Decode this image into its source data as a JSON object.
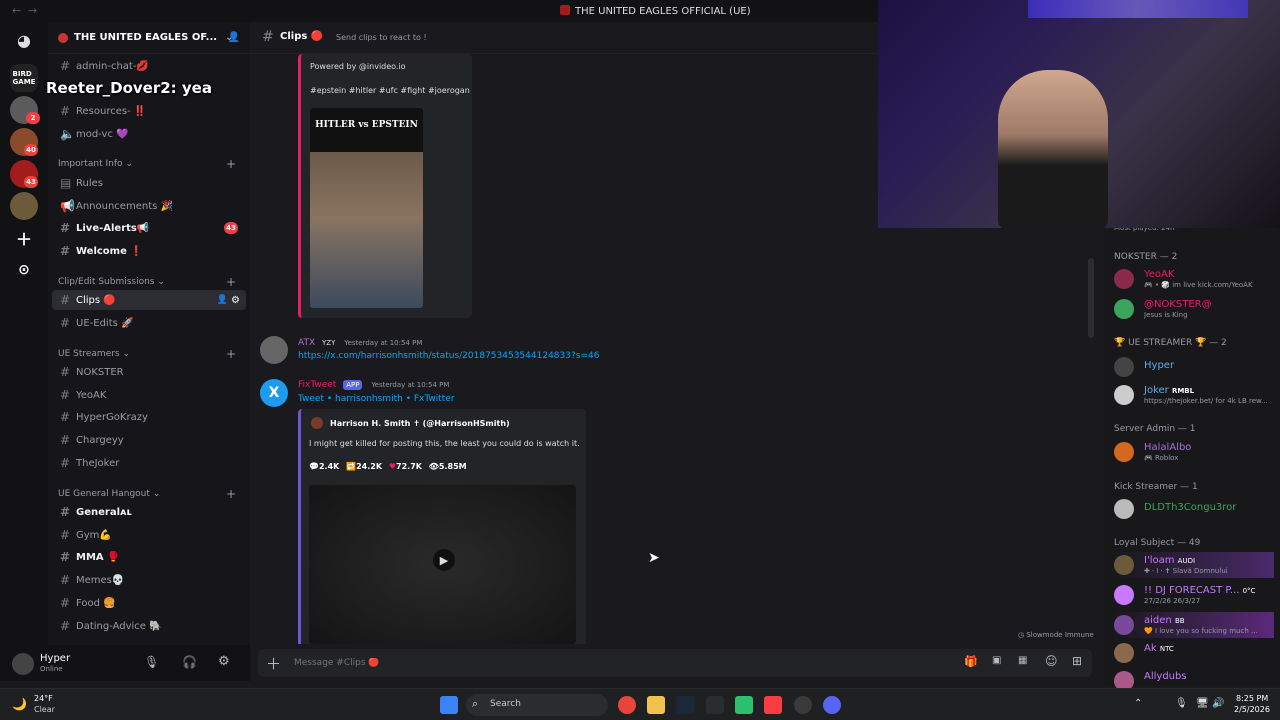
{
  "window": {
    "title": "THE UNITED EAGLES OFFICIAL (UE)"
  },
  "overlay_chat": {
    "text": "Reeter_Dover2: yea"
  },
  "server": {
    "name": "THE UNITED EAGLES OF..."
  },
  "server_rail": {
    "badges": [
      "2",
      "40",
      "43"
    ]
  },
  "channels": {
    "top": [
      {
        "label": "admin-chat-💋"
      },
      {
        "label": "Resources- ‼️"
      },
      {
        "label": "mod-vc 💜"
      }
    ],
    "categories": {
      "important": "Important Info",
      "clip_edit": "Clip/Edit Submissions",
      "streamers": "UE Streamers",
      "hangout": "UE General Hangout"
    },
    "important": [
      {
        "label": "Rules"
      },
      {
        "label": "Announcements 🎉"
      },
      {
        "label": "Live-Alerts📢",
        "badge": "43"
      },
      {
        "label": "Welcome ❗"
      }
    ],
    "clip_edit": [
      {
        "label": "Clips 🔴"
      },
      {
        "label": "UE-Edits 🚀"
      }
    ],
    "streamers": [
      {
        "label": "NOKSTER"
      },
      {
        "label": "YeoAK"
      },
      {
        "label": "HyperGoKrazy"
      },
      {
        "label": "Chargeyy"
      },
      {
        "label": "TheJoker"
      }
    ],
    "hangout": [
      {
        "label": "Generalᴀʟ"
      },
      {
        "label": "Gym💪"
      },
      {
        "label": "MMA 🥊"
      },
      {
        "label": "Memes💀"
      },
      {
        "label": "Food 🍔"
      },
      {
        "label": "Dating-Advice 🐘"
      }
    ]
  },
  "user": {
    "name": "Hyper",
    "status": "Online"
  },
  "channel_header": {
    "name": "Clips 🔴",
    "topic": "Send clips to react to !"
  },
  "messages": {
    "m0": {
      "powered_by": "Powered by @invideo.io",
      "tags": "#epstein #hitler #ufc #fight #joerogan",
      "thumb_title": "HITLER vs EPSTEIN"
    },
    "m1": {
      "author": "ATX",
      "tag": "YZY",
      "time": "Yesterday at 10:54 PM",
      "link": "https://x.com/harrisonhsmith/status/2018753453544124833?s=46"
    },
    "m2": {
      "author": "FixTweet",
      "app_tag": "APP",
      "time": "Yesterday at 10:54 PM",
      "source_tweet": "Tweet",
      "source_sep1": "•",
      "source_author": "harrisonhsmith",
      "source_sep2": "•",
      "source_site": "FxTwitter",
      "embed_author": "Harrison H. Smith ✝ (@HarrisonHSmith)",
      "embed_text": "I might get killed for posting this, the least you could do is watch it.",
      "stats": {
        "replies": "2.4K",
        "retweets": "24.2K",
        "likes": "72.7K",
        "views": "5.85M"
      }
    }
  },
  "slowmode": "Slowmode Immune",
  "input": {
    "placeholder": "Message #Clips 🔴"
  },
  "members": {
    "cut_top": "Most played: 24h",
    "groups": [
      {
        "title": "NOKSTER — 2"
      },
      {
        "title": "🏆 UE STREAMER 🏆 — 2"
      },
      {
        "title": "Server Admin — 1"
      },
      {
        "title": "Kick Streamer — 1"
      },
      {
        "title": "Loyal Subject — 49"
      }
    ],
    "list": [
      {
        "name": "YeoAK",
        "status": "🎮 • 🎲 im live kick.com/YeoAK",
        "color": "#e91e63"
      },
      {
        "name": "@NOKSTER@",
        "status": "Jesus is King",
        "color": "#e91e63"
      },
      {
        "name": "Hyper",
        "status": "",
        "color": "#5dadec"
      },
      {
        "name": "Joker",
        "tag": "RMBL",
        "status": "https://thejoker.bet/ for 4k LB rew...",
        "color": "#5dadec"
      },
      {
        "name": "HalalAlbo",
        "status": "🎮 Roblox",
        "color": "#a66fd6"
      },
      {
        "name": "DLDTh3Congu3ror",
        "status": "",
        "color": "#3ba55d"
      },
      {
        "name": "I'loam",
        "tag": "AUDI",
        "status": "✚ ⸱ I ⸱ ✝ Slavă Domnului",
        "color": "#c879ff"
      },
      {
        "name": "!! DJ FORECAST P...",
        "tag": "0°C",
        "status": "27/2/26 26/3/27",
        "color": "#c879ff"
      },
      {
        "name": "aiden",
        "tag": "BB",
        "status": "🧡 I love you so fucking much ...",
        "color": "#c879ff"
      },
      {
        "name": "Ak",
        "tag": "NTC",
        "status": "",
        "color": "#c879ff"
      },
      {
        "name": "Allydubs",
        "status": "",
        "color": "#c879ff"
      }
    ]
  },
  "taskbar": {
    "weather_temp": "24°F",
    "weather_text": "Clear",
    "search": "Search",
    "time": "8:25 PM",
    "date": "2/5/2026"
  }
}
